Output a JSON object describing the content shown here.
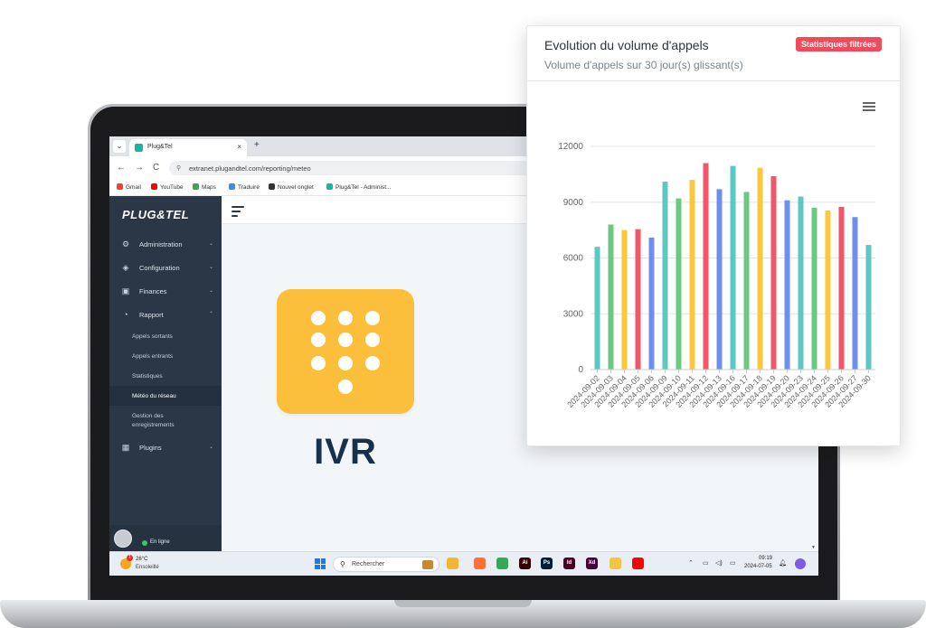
{
  "browser": {
    "tab_menu_icon": "chevron-down-icon",
    "tab_title": "Plug&Tel",
    "tab_close": "×",
    "tab_new": "+",
    "back": "←",
    "forward": "→",
    "reload": "C",
    "url": "extranet.plugandtel.com/reporting/meteo",
    "bookmarks": [
      {
        "label": "Gmail",
        "color": "#ea4335"
      },
      {
        "label": "YouTube",
        "color": "#ff0000"
      },
      {
        "label": "Maps",
        "color": "#34a853"
      },
      {
        "label": "Traduire",
        "color": "#4285f4"
      },
      {
        "label": "Nouvel onglet",
        "color": "#333333"
      },
      {
        "label": "Plug&Tel - Administ...",
        "color": "#16b7a0"
      }
    ]
  },
  "app": {
    "logo": "PLUG&TEL",
    "nav": [
      {
        "label": "Administration",
        "icon": "gear-icon",
        "glyph": "⚙",
        "chev": "⌄"
      },
      {
        "label": "Configuration",
        "icon": "cube-icon",
        "glyph": "◈",
        "chev": "⌄"
      },
      {
        "label": "Finances",
        "icon": "briefcase-icon",
        "glyph": "▣",
        "chev": "⌄"
      },
      {
        "label": "Rapport",
        "icon": "clock-icon",
        "glyph": "◔",
        "chev": "⌃"
      }
    ],
    "rapport_sub": [
      "Appels sortants",
      "Appels entrants",
      "Statistiques",
      "Météo du réseau",
      "Gestion des enregistrements"
    ],
    "plugins": {
      "label": "Plugins",
      "icon": "grid-icon",
      "glyph": "▦",
      "chev": "⌄"
    },
    "status": "En ligne"
  },
  "ivr": {
    "label": "IVR"
  },
  "taskbar": {
    "temp": "26°C",
    "weather": "Ensoleillé",
    "weather_badge": "1",
    "search_placeholder": "Rechercher",
    "time": "09:19",
    "date": "2024-07-05",
    "apps": [
      {
        "name": "file-explorer-icon",
        "label": "",
        "color": "#f2b630"
      },
      {
        "name": "firefox-icon",
        "label": "",
        "color": "#ff7139"
      },
      {
        "name": "chrome-icon",
        "label": "",
        "color": "#34a853"
      },
      {
        "name": "illustrator-icon",
        "label": "Ai",
        "color": "#330000"
      },
      {
        "name": "photoshop-icon",
        "label": "Ps",
        "color": "#001e36"
      },
      {
        "name": "indesign-icon",
        "label": "Id",
        "color": "#49021f"
      },
      {
        "name": "xd-icon",
        "label": "Xd",
        "color": "#470137"
      },
      {
        "name": "folder-icon",
        "label": "",
        "color": "#f4c542"
      },
      {
        "name": "youtube-icon",
        "label": "",
        "color": "#ff0000"
      }
    ]
  },
  "card": {
    "title": "Evolution du volume d'appels",
    "subtitle": "Volume d'appels sur 30 jour(s) glissant(s)",
    "badge": "Statistiques filtrées"
  },
  "chart_data": {
    "type": "bar",
    "categories": [
      "2024-09-02",
      "2024-09-03",
      "2024-09-04",
      "2024-09-05",
      "2024-09-06",
      "2024-09-09",
      "2024-09-10",
      "2024-09-11",
      "2024-09-12",
      "2024-09-13",
      "2024-09-16",
      "2024-09-17",
      "2024-09-18",
      "2024-09-19",
      "2024-09-20",
      "2024-09-23",
      "2024-09-24",
      "2024-09-25",
      "2024-09-26",
      "2024-09-27",
      "2024-09-30"
    ],
    "values": [
      6600,
      7800,
      7500,
      7550,
      7100,
      10100,
      9200,
      10200,
      11100,
      9700,
      10950,
      9550,
      10850,
      10400,
      9100,
      9300,
      8700,
      8550,
      8750,
      8200,
      6700
    ],
    "colors": [
      "#5cc8c1",
      "#6cc982",
      "#fcc73c",
      "#f2566a",
      "#6d8ff0",
      "#5cc8c1",
      "#6cc982",
      "#fcc73c",
      "#f2566a",
      "#6d8ff0",
      "#5cc8c1",
      "#6cc982",
      "#fcc73c",
      "#f2566a",
      "#6d8ff0",
      "#5cc8c1",
      "#6cc982",
      "#fcc73c",
      "#f2566a",
      "#6d8ff0",
      "#5cc8c1"
    ],
    "yticks": [
      0,
      3000,
      6000,
      9000,
      12000
    ],
    "ylim": [
      0,
      12000
    ],
    "grid": true,
    "xlabel": "",
    "ylabel": ""
  }
}
